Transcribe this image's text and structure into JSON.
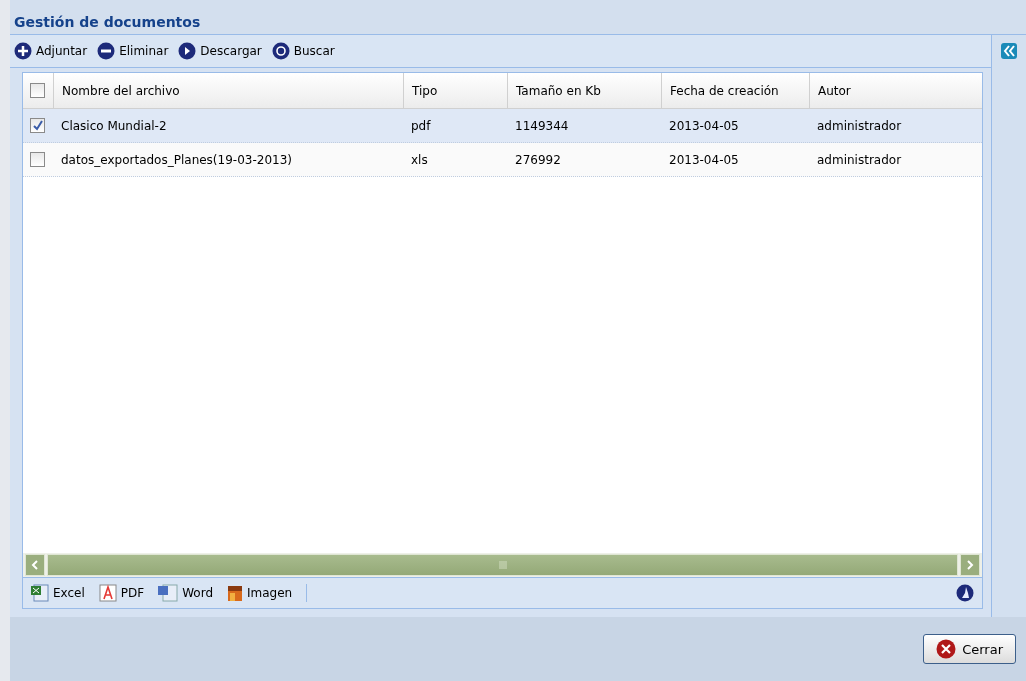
{
  "window": {
    "title": "Gestión de documentos"
  },
  "toolbar": [
    {
      "kind": "add",
      "label": "Adjuntar"
    },
    {
      "kind": "remove",
      "label": "Eliminar"
    },
    {
      "kind": "download",
      "label": "Descargar"
    },
    {
      "kind": "search",
      "label": "Buscar"
    }
  ],
  "table": {
    "select_all": {
      "checked": false
    },
    "columns": [
      "Nombre del archivo",
      "Tipo",
      "Tamaño en Kb",
      "Fecha de creación",
      "Autor"
    ],
    "rows": [
      {
        "selected": true,
        "checked": true,
        "cells": [
          "Clasico Mundial-2",
          "pdf",
          "1149344",
          "2013-04-05",
          "administrador"
        ]
      },
      {
        "selected": false,
        "checked": false,
        "cells": [
          "datos_exportados_Planes(19-03-2013)",
          "xls",
          "276992",
          "2013-04-05",
          "administrador"
        ]
      }
    ]
  },
  "export_bar": [
    {
      "kind": "excel",
      "label": "Excel"
    },
    {
      "kind": "pdf",
      "label": "PDF"
    },
    {
      "kind": "word",
      "label": "Word"
    },
    {
      "kind": "image",
      "label": "Imagen"
    }
  ],
  "buttons": [
    {
      "kind": "close",
      "label": "Cerrar"
    }
  ]
}
